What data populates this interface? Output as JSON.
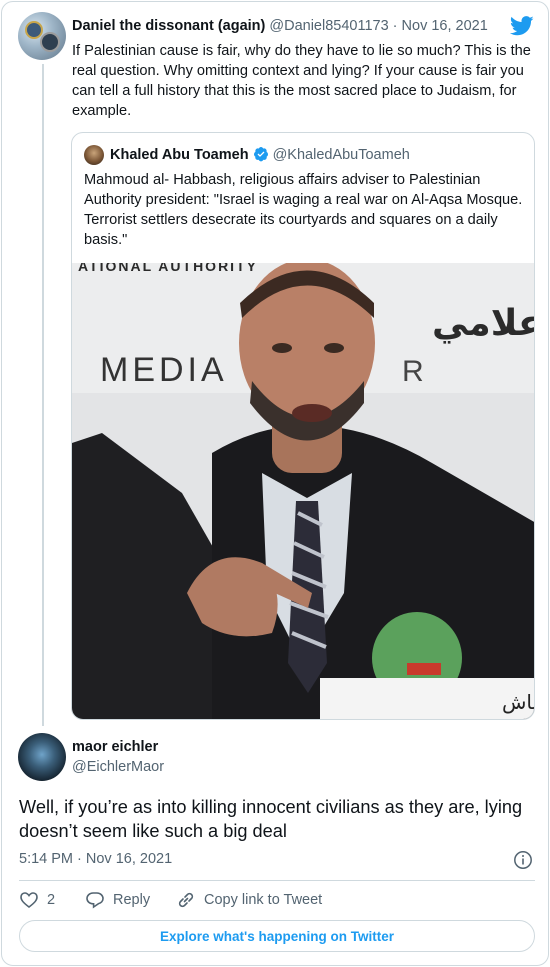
{
  "parent_tweet": {
    "display_name": "Daniel the dissonant (again)",
    "handle": "@Daniel85401173",
    "separator": " · ",
    "date": "Nov 16, 2021",
    "text": "If Palestinian cause is fair, why do they have to lie so much? This is the real question. Why omitting context and lying? If your cause is fair you can tell a full history that this is the most sacred place to Judaism, for example."
  },
  "quoted_tweet": {
    "display_name": "Khaled Abu Toameh",
    "handle": "@KhaledAbuToameh",
    "text": "Mahmoud al- Habbash, religious affairs adviser to Palestinian Authority president: \"Israel is waging a real war on Al-Aqsa Mosque. Terrorist settlers desecrate its courtyards and squares on a daily basis.\"",
    "image": {
      "banner_top": "ATIONAL AUTHORITY",
      "banner_arabic": "المركز الإعلامي",
      "banner_media": "MEDIA",
      "banner_r": "R",
      "nameplate": "د. محمود الهباش"
    }
  },
  "reply_tweet": {
    "display_name": "maor eichler",
    "handle": "@EichlerMaor",
    "text": "Well, if you’re as into killing innocent civilians as they are, lying doesn’t seem like such a big deal",
    "timestamp": "5:14 PM · Nov 16, 2021",
    "like_count": "2",
    "reply_label": "Reply",
    "copy_link_label": "Copy link to Tweet"
  },
  "explore_button": "Explore what's happening on Twitter",
  "colors": {
    "accent": "#1d9bf0",
    "text": "#0f1419",
    "secondary": "#536471",
    "border": "#cfd9de"
  },
  "icons": [
    "twitter-bird-icon",
    "verified-badge-icon",
    "info-icon",
    "heart-icon",
    "reply-icon",
    "link-icon"
  ]
}
